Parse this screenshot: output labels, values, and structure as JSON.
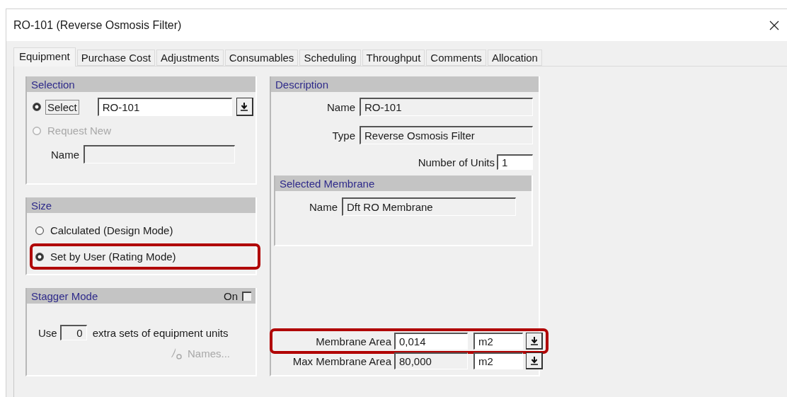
{
  "window": {
    "title": "RO-101 (Reverse Osmosis Filter)"
  },
  "tabs": [
    {
      "label": "Equipment",
      "selected": true
    },
    {
      "label": "Purchase Cost",
      "selected": false
    },
    {
      "label": "Adjustments",
      "selected": false
    },
    {
      "label": "Consumables",
      "selected": false
    },
    {
      "label": "Scheduling",
      "selected": false
    },
    {
      "label": "Throughput",
      "selected": false
    },
    {
      "label": "Comments",
      "selected": false
    },
    {
      "label": "Allocation",
      "selected": false
    }
  ],
  "selection": {
    "title": "Selection",
    "options": [
      {
        "label": "Select",
        "selected": true,
        "disabled": false
      },
      {
        "label": "Request New",
        "selected": false,
        "disabled": true
      }
    ],
    "combo_value": "RO-101",
    "name_label": "Name"
  },
  "size": {
    "title": "Size",
    "options": [
      {
        "label": "Calculated (Design Mode)",
        "selected": false,
        "highlighted": false
      },
      {
        "label": "Set by User (Rating Mode)",
        "selected": true,
        "highlighted": true
      }
    ]
  },
  "stagger": {
    "title": "Stagger Mode",
    "toggle_label": "On",
    "checked": false,
    "prefix": "Use",
    "count": "0",
    "suffix": "extra sets of equipment units",
    "names_button": {
      "label": "Names...",
      "disabled": true
    }
  },
  "description": {
    "title": "Description",
    "fields": [
      {
        "label": "Name",
        "value": "RO-101"
      },
      {
        "label": "Type",
        "value": "Reverse Osmosis Filter"
      }
    ],
    "units_label": "Number of Units",
    "units_value": "1"
  },
  "membrane": {
    "title": "Selected Membrane",
    "name_label": "Name",
    "name_value": "Dft RO Membrane"
  },
  "areas": [
    {
      "label": "Membrane Area",
      "value": "0,014",
      "unit": "m2",
      "highlighted": true,
      "disabled": false
    },
    {
      "label": "Max Membrane Area",
      "value": "80,000",
      "unit": "m2",
      "highlighted": false,
      "disabled": true
    }
  ]
}
